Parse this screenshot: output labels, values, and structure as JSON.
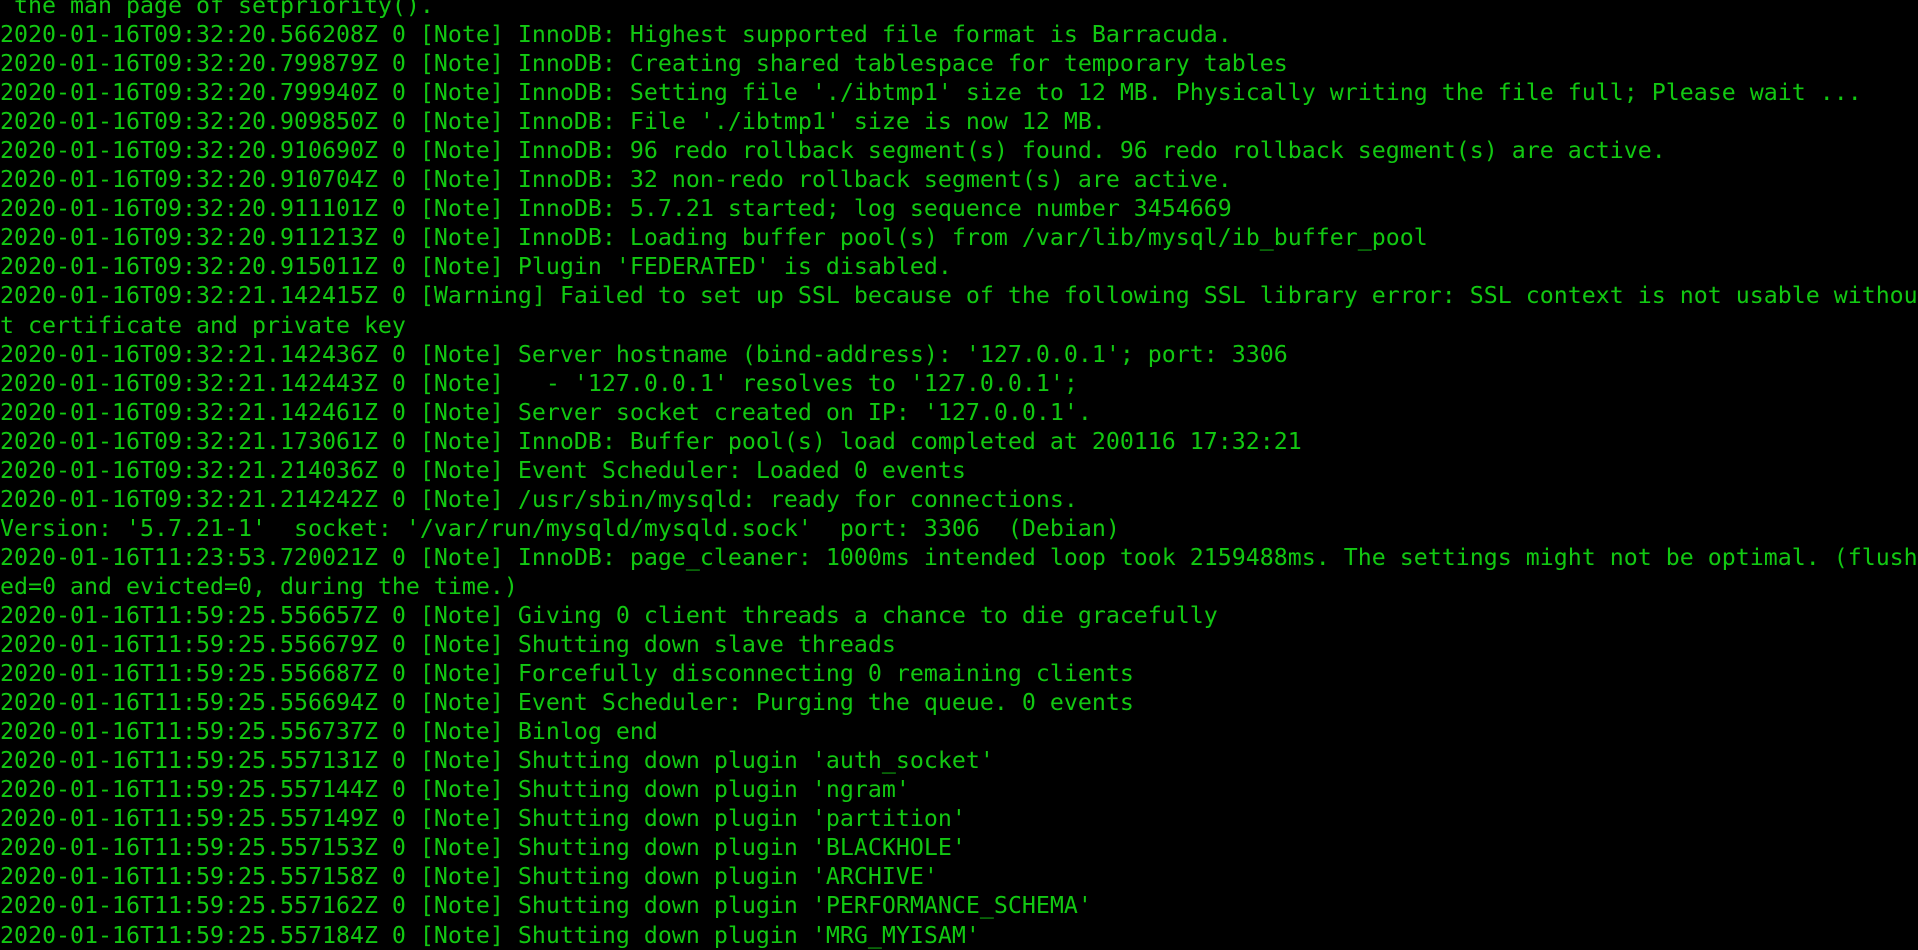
{
  "terminal": {
    "text_color": "#12c812",
    "background_color": "#000000",
    "lines": [
      " the man page of setpriority().",
      "2020-01-16T09:32:20.566208Z 0 [Note] InnoDB: Highest supported file format is Barracuda.",
      "2020-01-16T09:32:20.799879Z 0 [Note] InnoDB: Creating shared tablespace for temporary tables",
      "2020-01-16T09:32:20.799940Z 0 [Note] InnoDB: Setting file './ibtmp1' size to 12 MB. Physically writing the file full; Please wait ...",
      "2020-01-16T09:32:20.909850Z 0 [Note] InnoDB: File './ibtmp1' size is now 12 MB.",
      "2020-01-16T09:32:20.910690Z 0 [Note] InnoDB: 96 redo rollback segment(s) found. 96 redo rollback segment(s) are active.",
      "2020-01-16T09:32:20.910704Z 0 [Note] InnoDB: 32 non-redo rollback segment(s) are active.",
      "2020-01-16T09:32:20.911101Z 0 [Note] InnoDB: 5.7.21 started; log sequence number 3454669",
      "2020-01-16T09:32:20.911213Z 0 [Note] InnoDB: Loading buffer pool(s) from /var/lib/mysql/ib_buffer_pool",
      "2020-01-16T09:32:20.915011Z 0 [Note] Plugin 'FEDERATED' is disabled.",
      "2020-01-16T09:32:21.142415Z 0 [Warning] Failed to set up SSL because of the following SSL library error: SSL context is not usable withou",
      "t certificate and private key",
      "2020-01-16T09:32:21.142436Z 0 [Note] Server hostname (bind-address): '127.0.0.1'; port: 3306",
      "2020-01-16T09:32:21.142443Z 0 [Note]   - '127.0.0.1' resolves to '127.0.0.1';",
      "2020-01-16T09:32:21.142461Z 0 [Note] Server socket created on IP: '127.0.0.1'.",
      "2020-01-16T09:32:21.173061Z 0 [Note] InnoDB: Buffer pool(s) load completed at 200116 17:32:21",
      "2020-01-16T09:32:21.214036Z 0 [Note] Event Scheduler: Loaded 0 events",
      "2020-01-16T09:32:21.214242Z 0 [Note] /usr/sbin/mysqld: ready for connections.",
      "Version: '5.7.21-1'  socket: '/var/run/mysqld/mysqld.sock'  port: 3306  (Debian)",
      "2020-01-16T11:23:53.720021Z 0 [Note] InnoDB: page_cleaner: 1000ms intended loop took 2159488ms. The settings might not be optimal. (flush",
      "ed=0 and evicted=0, during the time.)",
      "2020-01-16T11:59:25.556657Z 0 [Note] Giving 0 client threads a chance to die gracefully",
      "2020-01-16T11:59:25.556679Z 0 [Note] Shutting down slave threads",
      "2020-01-16T11:59:25.556687Z 0 [Note] Forcefully disconnecting 0 remaining clients",
      "2020-01-16T11:59:25.556694Z 0 [Note] Event Scheduler: Purging the queue. 0 events",
      "2020-01-16T11:59:25.556737Z 0 [Note] Binlog end",
      "2020-01-16T11:59:25.557131Z 0 [Note] Shutting down plugin 'auth_socket'",
      "2020-01-16T11:59:25.557144Z 0 [Note] Shutting down plugin 'ngram'",
      "2020-01-16T11:59:25.557149Z 0 [Note] Shutting down plugin 'partition'",
      "2020-01-16T11:59:25.557153Z 0 [Note] Shutting down plugin 'BLACKHOLE'",
      "2020-01-16T11:59:25.557158Z 0 [Note] Shutting down plugin 'ARCHIVE'",
      "2020-01-16T11:59:25.557162Z 0 [Note] Shutting down plugin 'PERFORMANCE_SCHEMA'",
      "2020-01-16T11:59:25.557184Z 0 [Note] Shutting down plugin 'MRG_MYISAM'"
    ]
  }
}
